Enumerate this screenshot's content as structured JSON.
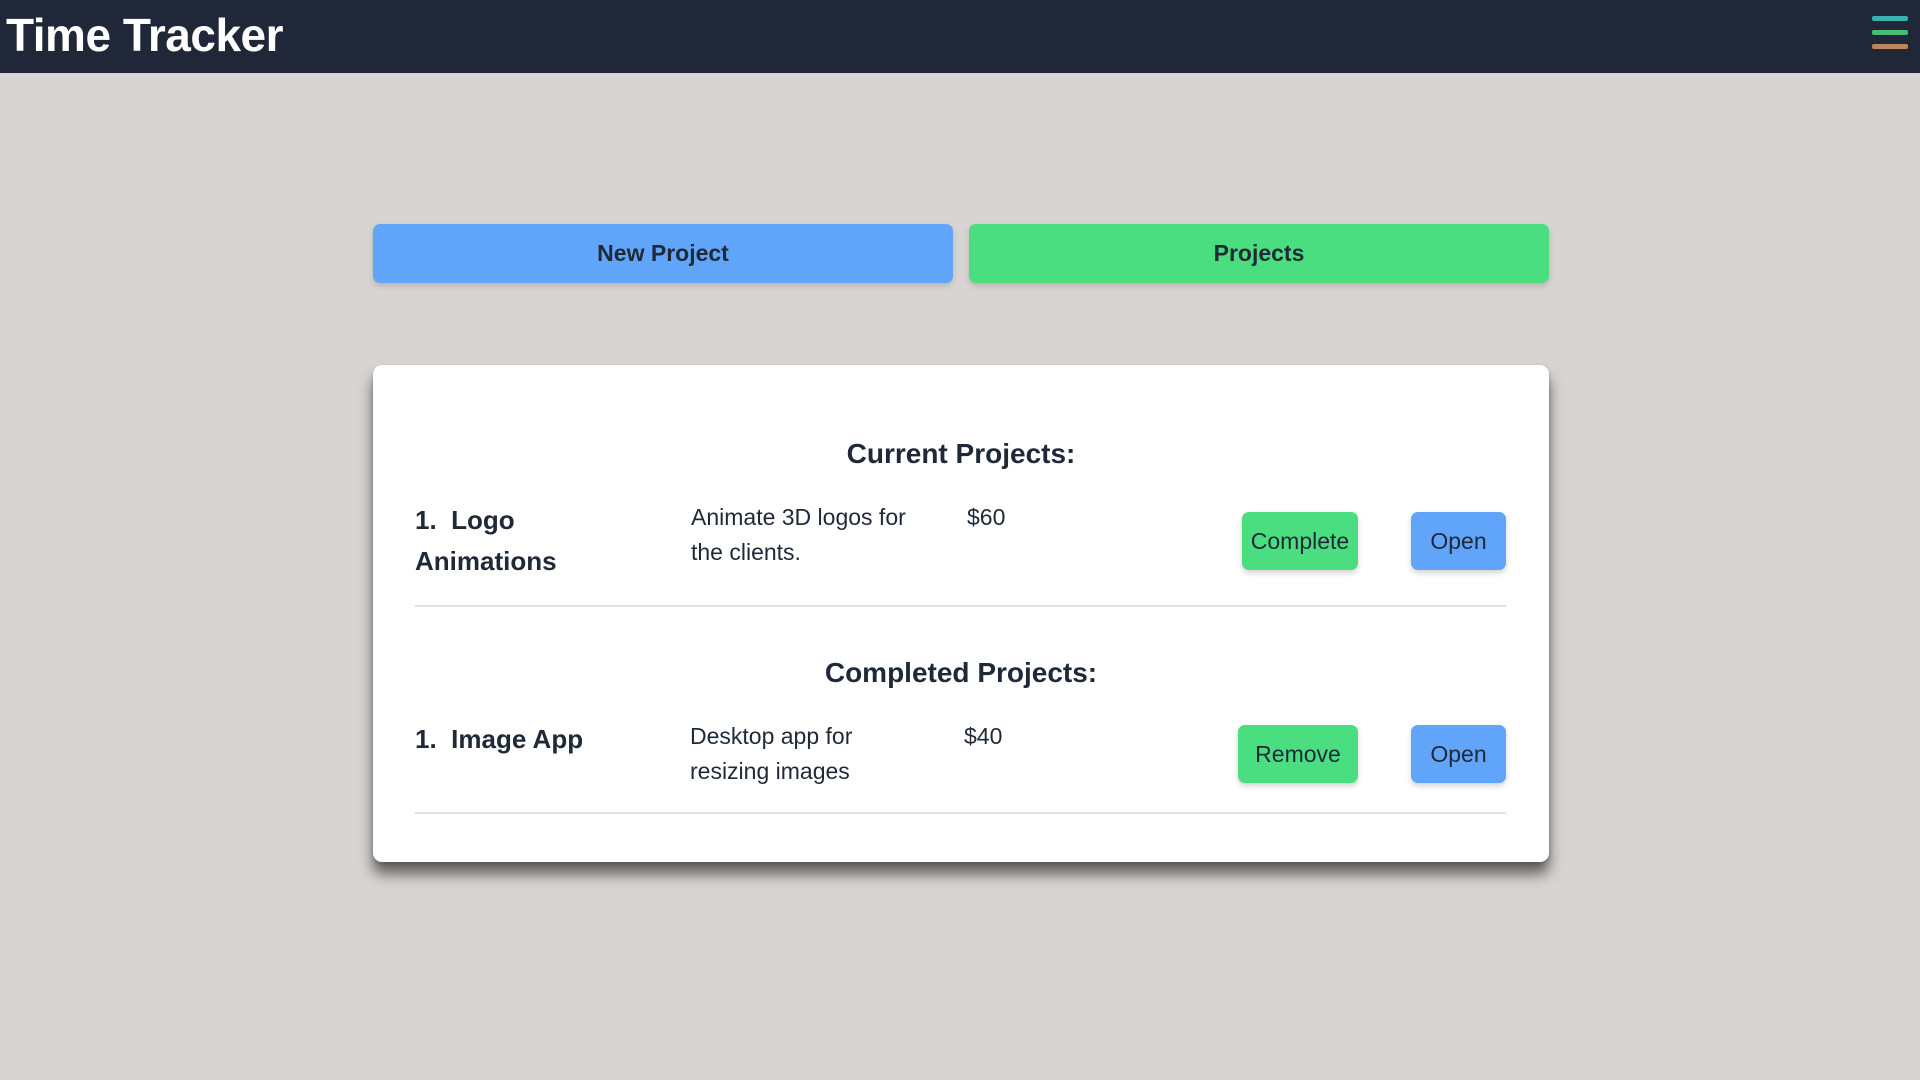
{
  "app": {
    "title": "Time Tracker"
  },
  "menu": {
    "icon": "hamburger-menu-icon",
    "bar_colors": [
      "#38b2ac",
      "#48bb78",
      "#c0845a"
    ]
  },
  "nav": {
    "new_project_label": "New Project",
    "projects_label": "Projects"
  },
  "colors": {
    "header_bg": "#1f2738",
    "page_bg": "#d7d4d1",
    "blue_button": "#60a5fa",
    "green_button": "#4ade80"
  },
  "current": {
    "heading": "Current Projects:",
    "items": [
      {
        "number": "1.",
        "name_line1": "Logo",
        "name_line2": "Animations",
        "desc_line1": "Animate 3D logos for",
        "desc_line2": "the clients.",
        "price": "$60",
        "primary_action": "Complete",
        "secondary_action": "Open"
      }
    ]
  },
  "completed": {
    "heading": "Completed Projects:",
    "items": [
      {
        "number": "1.",
        "name": "Image App",
        "desc_line1": "Desktop app for",
        "desc_line2": "resizing images",
        "price": "$40",
        "primary_action": "Remove",
        "secondary_action": "Open"
      }
    ]
  }
}
